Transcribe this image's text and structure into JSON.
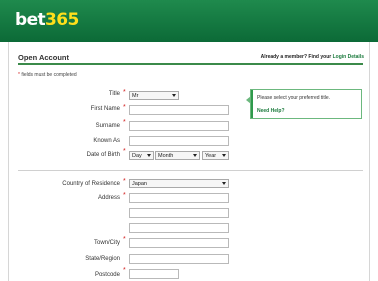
{
  "header": {
    "logo_main": "bet",
    "logo_accent": "365"
  },
  "page": {
    "section_title": "Open Account",
    "member_prompt": "Already a member? Find your ",
    "login_link": "Login Details",
    "required_note": "fields must be completed",
    "required_star": "*"
  },
  "form": {
    "title": {
      "label": "Title",
      "value": "Mr"
    },
    "first_name": {
      "label": "First Name"
    },
    "surname": {
      "label": "Surname"
    },
    "known_as": {
      "label": "Known As"
    },
    "dob": {
      "label": "Date of Birth",
      "day": "Day",
      "month": "Month",
      "year": "Year"
    },
    "country": {
      "label": "Country of Residence",
      "value": "Japan"
    },
    "address": {
      "label": "Address"
    },
    "town": {
      "label": "Town/City"
    },
    "state": {
      "label": "State/Region"
    },
    "postcode": {
      "label": "Postcode"
    }
  },
  "tooltip": {
    "message": "Please select your preferred title.",
    "help_link": "Need Help?"
  },
  "colors": {
    "header_green": "#14783f",
    "logo_yellow": "#ffdf1b",
    "required_red": "#d21b1b",
    "link_green": "#1a7a3c"
  }
}
